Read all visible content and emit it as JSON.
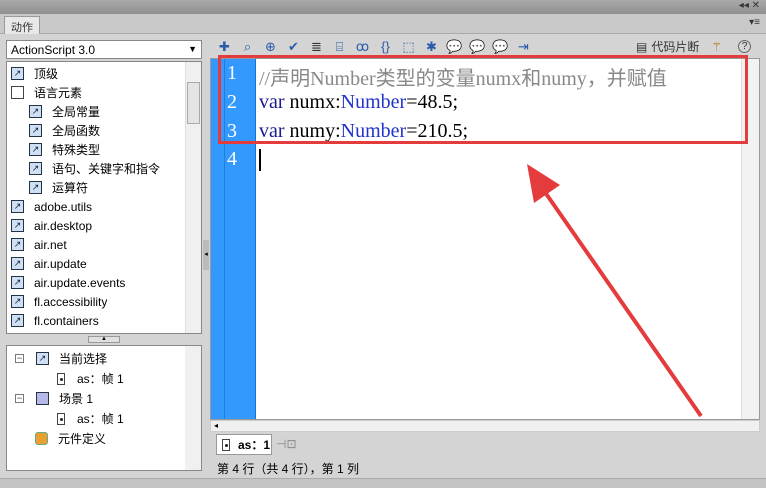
{
  "panel": {
    "tab": "动作",
    "window_controls": "◂◂ ✕",
    "menu": "▾≡"
  },
  "language_select": {
    "value": "ActionScript 3.0"
  },
  "tree": [
    {
      "label": "顶级",
      "icon": "package-icon",
      "indent": 0
    },
    {
      "label": "语言元素",
      "icon": "book-icon",
      "indent": 0
    },
    {
      "label": "全局常量",
      "icon": "package-icon",
      "indent": 1
    },
    {
      "label": "全局函数",
      "icon": "package-icon",
      "indent": 1
    },
    {
      "label": "特殊类型",
      "icon": "package-icon",
      "indent": 1
    },
    {
      "label": "语句、关键字和指令",
      "icon": "package-icon",
      "indent": 1
    },
    {
      "label": "运算符",
      "icon": "package-icon",
      "indent": 1
    },
    {
      "label": "adobe.utils",
      "icon": "package-icon",
      "indent": 0
    },
    {
      "label": "air.desktop",
      "icon": "package-icon",
      "indent": 0
    },
    {
      "label": "air.net",
      "icon": "package-icon",
      "indent": 0
    },
    {
      "label": "air.update",
      "icon": "package-icon",
      "indent": 0
    },
    {
      "label": "air.update.events",
      "icon": "package-icon",
      "indent": 0
    },
    {
      "label": "fl.accessibility",
      "icon": "package-icon",
      "indent": 0
    },
    {
      "label": "fl.containers",
      "icon": "package-icon",
      "indent": 0
    }
  ],
  "scope": {
    "current_selection": "当前选择",
    "current_frame": "as：帧 1",
    "scene": "场景 1",
    "scene_frame": "as：帧 1",
    "symbol_defs": "元件定义"
  },
  "toolbar": {
    "snippets": "代码片断"
  },
  "code": {
    "line_numbers": [
      "1",
      "2",
      "3",
      "4"
    ],
    "line1_comment": "//声明Number类型的变量numx和numy，并赋值",
    "line2": {
      "kw": "var",
      "name": " numx:",
      "type": "Number",
      "rest": "=48.5;"
    },
    "line3": {
      "kw": "var",
      "name": " numy:",
      "type": "Number",
      "rest": "=210.5;"
    }
  },
  "script_tab": "as：1",
  "status": "第 4 行（共 4 行），第 1 列",
  "colors": {
    "gutter": "#3399ff",
    "highlight": "#e43c3c"
  }
}
